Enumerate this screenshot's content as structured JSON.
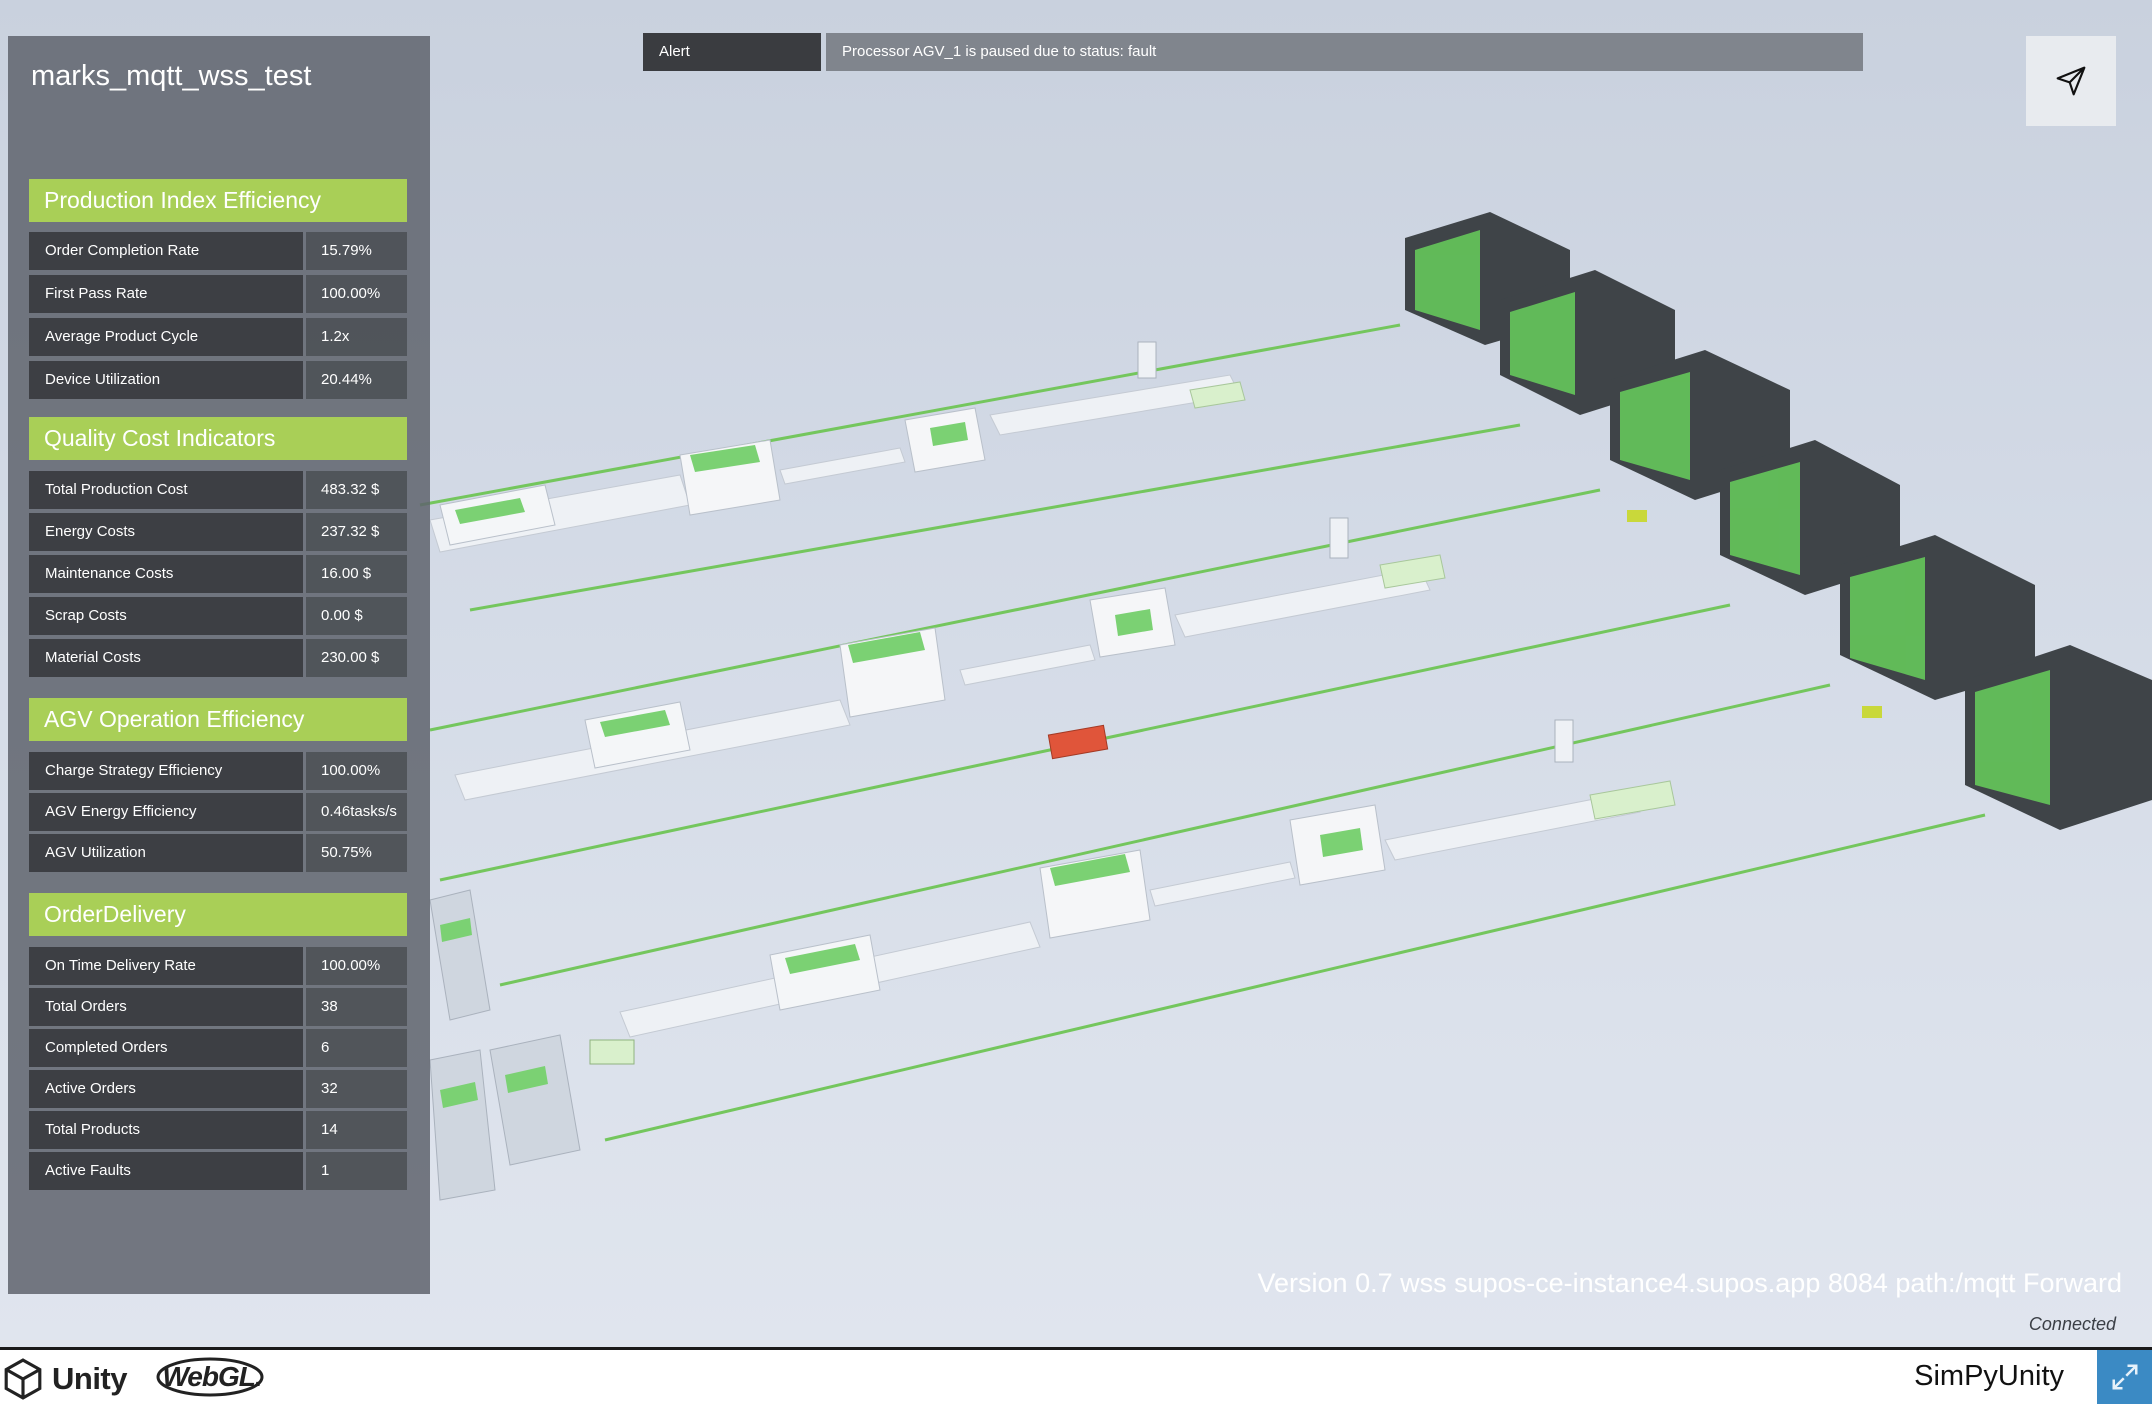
{
  "project_title": "marks_mqtt_wss_test",
  "alert": {
    "label": "Alert",
    "message": "Processor AGV_1 is paused due to status: fault"
  },
  "sections": [
    {
      "title": "Production Index Efficiency",
      "rows": [
        {
          "label": "Order Completion Rate",
          "value": "15.79%"
        },
        {
          "label": "First Pass Rate",
          "value": "100.00%"
        },
        {
          "label": "Average Product Cycle",
          "value": "1.2x"
        },
        {
          "label": "Device Utilization",
          "value": "20.44%"
        }
      ]
    },
    {
      "title": "Quality Cost Indicators",
      "rows": [
        {
          "label": "Total Production Cost",
          "value": "483.32 $"
        },
        {
          "label": "Energy Costs",
          "value": "237.32 $"
        },
        {
          "label": "Maintenance Costs",
          "value": "16.00 $"
        },
        {
          "label": "Scrap Costs",
          "value": "0.00 $"
        },
        {
          "label": "Material Costs",
          "value": "230.00 $"
        }
      ]
    },
    {
      "title": "AGV Operation Efficiency",
      "rows": [
        {
          "label": "Charge Strategy Efficiency",
          "value": "100.00%"
        },
        {
          "label": "AGV Energy Efficiency",
          "value": "0.46tasks/s"
        },
        {
          "label": "AGV Utilization",
          "value": "50.75%"
        }
      ]
    },
    {
      "title": "OrderDelivery",
      "rows": [
        {
          "label": "On Time Delivery Rate",
          "value": "100.00%"
        },
        {
          "label": "Total Orders",
          "value": "38"
        },
        {
          "label": "Completed Orders",
          "value": "6"
        },
        {
          "label": "Active Orders",
          "value": "32"
        },
        {
          "label": "Total Products",
          "value": "14"
        },
        {
          "label": "Active Faults",
          "value": "1"
        }
      ]
    }
  ],
  "version_info": "Version 0.7 wss supos-ce-instance4.supos.app  8084 path:/mqtt Forward",
  "connection_status": "Connected",
  "footer": {
    "unity_label": "Unity",
    "webgl_label": "WebGL.",
    "app_name": "SimPyUnity"
  },
  "icons": {
    "send": "send-icon",
    "fullscreen": "fullscreen-icon",
    "unity": "unity-logo-icon"
  },
  "colors": {
    "section_header": "#a9cf57",
    "label_background": "#3d3f44",
    "accent_green": "#7ccd6a",
    "fullscreen_button": "#3b8ac4",
    "agv_fault": "#e0553a"
  }
}
